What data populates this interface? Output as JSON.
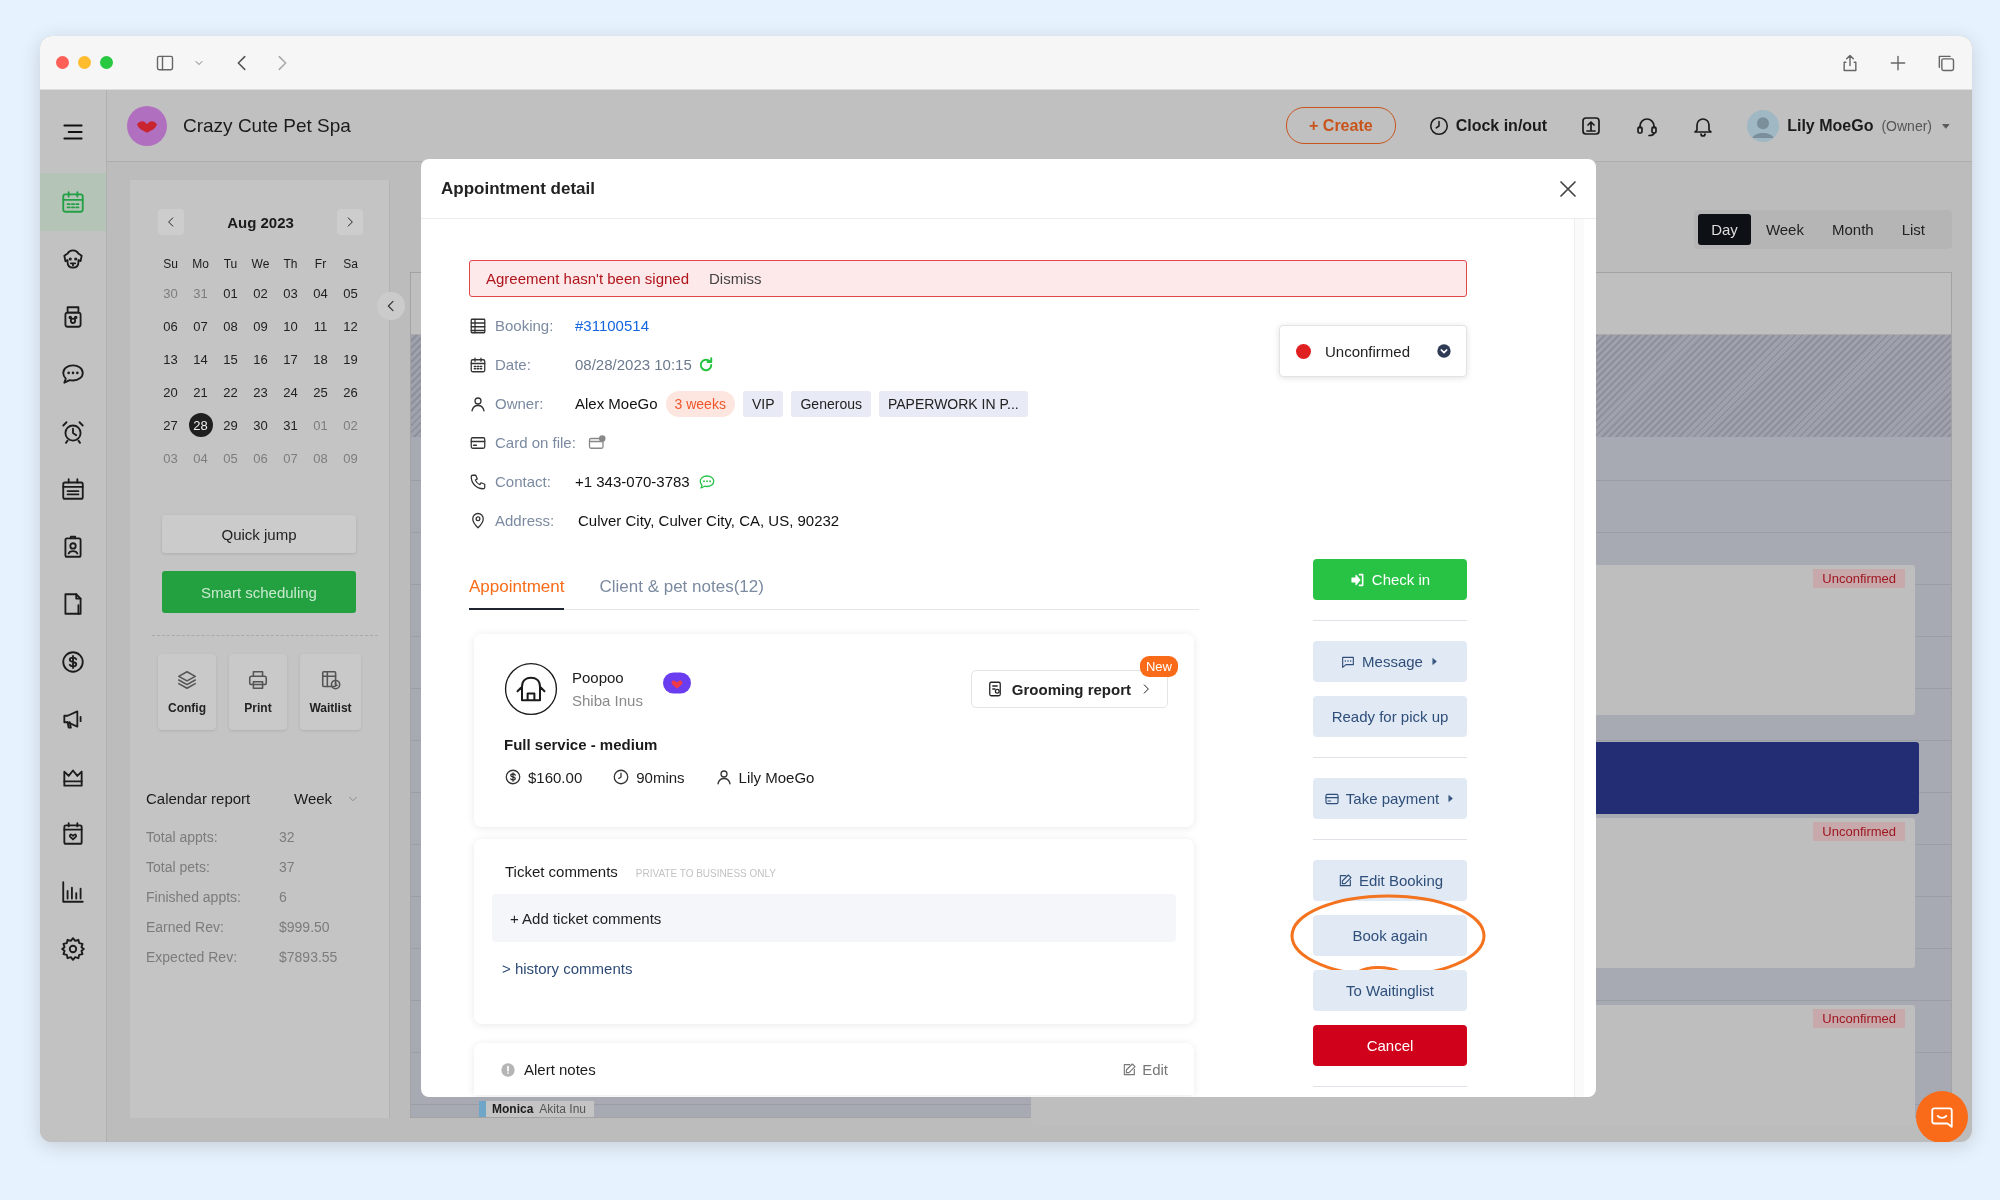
{
  "header": {
    "business_name": "Crazy Cute Pet Spa",
    "create": "+ Create",
    "clock": "Clock in/out",
    "user_name": "Lily MoeGo",
    "user_role": "(Owner)"
  },
  "nav": [
    {
      "selected": true
    },
    {
      "selected": false
    },
    {
      "selected": false
    },
    {
      "selected": false
    },
    {
      "selected": false
    },
    {
      "selected": false
    },
    {
      "selected": false
    },
    {
      "selected": false
    },
    {
      "selected": false
    },
    {
      "selected": false
    },
    {
      "selected": false
    },
    {
      "selected": false
    },
    {
      "selected": false
    },
    {
      "selected": false
    }
  ],
  "mini_calendar": {
    "title": "Aug 2023",
    "weekdays": [
      "Su",
      "Mo",
      "Tu",
      "We",
      "Th",
      "Fr",
      "Sa"
    ],
    "weeks": [
      [
        {
          "label": "30",
          "muted": true,
          "selected": false
        },
        {
          "label": "31",
          "muted": true,
          "selected": false
        },
        {
          "label": "01",
          "muted": false,
          "selected": false
        },
        {
          "label": "02",
          "muted": false,
          "selected": false
        },
        {
          "label": "03",
          "muted": false,
          "selected": false
        },
        {
          "label": "04",
          "muted": false,
          "selected": false
        },
        {
          "label": "05",
          "muted": false,
          "selected": false
        }
      ],
      [
        {
          "label": "06",
          "muted": false,
          "selected": false
        },
        {
          "label": "07",
          "muted": false,
          "selected": false
        },
        {
          "label": "08",
          "muted": false,
          "selected": false
        },
        {
          "label": "09",
          "muted": false,
          "selected": false
        },
        {
          "label": "10",
          "muted": false,
          "selected": false
        },
        {
          "label": "11",
          "muted": false,
          "selected": false
        },
        {
          "label": "12",
          "muted": false,
          "selected": false
        }
      ],
      [
        {
          "label": "13",
          "muted": false,
          "selected": false
        },
        {
          "label": "14",
          "muted": false,
          "selected": false
        },
        {
          "label": "15",
          "muted": false,
          "selected": false
        },
        {
          "label": "16",
          "muted": false,
          "selected": false
        },
        {
          "label": "17",
          "muted": false,
          "selected": false
        },
        {
          "label": "18",
          "muted": false,
          "selected": false
        },
        {
          "label": "19",
          "muted": false,
          "selected": false
        }
      ],
      [
        {
          "label": "20",
          "muted": false,
          "selected": false
        },
        {
          "label": "21",
          "muted": false,
          "selected": false
        },
        {
          "label": "22",
          "muted": false,
          "selected": false
        },
        {
          "label": "23",
          "muted": false,
          "selected": false
        },
        {
          "label": "24",
          "muted": false,
          "selected": false
        },
        {
          "label": "25",
          "muted": false,
          "selected": false
        },
        {
          "label": "26",
          "muted": false,
          "selected": false
        }
      ],
      [
        {
          "label": "27",
          "muted": false,
          "selected": false
        },
        {
          "label": "28",
          "muted": false,
          "selected": true
        },
        {
          "label": "29",
          "muted": false,
          "selected": false
        },
        {
          "label": "30",
          "muted": false,
          "selected": false
        },
        {
          "label": "31",
          "muted": false,
          "selected": false
        },
        {
          "label": "01",
          "muted": true,
          "selected": false
        },
        {
          "label": "02",
          "muted": true,
          "selected": false
        }
      ],
      [
        {
          "label": "03",
          "muted": true,
          "selected": false
        },
        {
          "label": "04",
          "muted": true,
          "selected": false
        },
        {
          "label": "05",
          "muted": true,
          "selected": false
        },
        {
          "label": "06",
          "muted": true,
          "selected": false
        },
        {
          "label": "07",
          "muted": true,
          "selected": false
        },
        {
          "label": "08",
          "muted": true,
          "selected": false
        },
        {
          "label": "09",
          "muted": true,
          "selected": false
        }
      ]
    ]
  },
  "quick_jump": "Quick jump",
  "smart_scheduling": "Smart scheduling",
  "tools": [
    {
      "kind": "layers",
      "label": "Config"
    },
    {
      "kind": "printer",
      "label": "Print"
    },
    {
      "kind": "waitlist",
      "label": "Waitlist"
    }
  ],
  "report": {
    "title": "Calendar report",
    "period": "Week",
    "stats": [
      {
        "label": "Total appts:",
        "value": "32"
      },
      {
        "label": "Total pets:",
        "value": "37"
      },
      {
        "label": "Finished appts:",
        "value": "6"
      },
      {
        "label": "Earned Rev:",
        "value": "$999.50"
      },
      {
        "label": "Expected Rev:",
        "value": "$7893.55"
      }
    ]
  },
  "views": [
    {
      "label": "Day",
      "selected": true
    },
    {
      "label": "Week",
      "selected": false
    },
    {
      "label": "Month",
      "selected": false
    },
    {
      "label": "List",
      "selected": false
    }
  ],
  "calendar_events": [
    {
      "kind": "appointment",
      "tag": "Unconfirmed"
    },
    {
      "kind": "blocked"
    },
    {
      "kind": "appointment",
      "tag": "Unconfirmed"
    },
    {
      "kind": "appointment",
      "tag": "Unconfirmed"
    },
    {
      "kind": "chip",
      "name": "Monica",
      "breed": "Akita Inu"
    }
  ],
  "modal": {
    "title": "Appointment detail",
    "alert": {
      "message": "Agreement hasn't been signed",
      "action": "Dismiss"
    },
    "details": [
      {
        "kind": "booking",
        "label": "Booking:",
        "value": "#31100514"
      },
      {
        "kind": "date",
        "label": "Date:",
        "value": "08/28/2023 10:15"
      },
      {
        "kind": "owner",
        "label": "Owner:",
        "value": "Alex MoeGo",
        "tags": [
          {
            "kind": "frequency",
            "text": "3 weeks"
          },
          {
            "kind": "tag",
            "text": "VIP"
          },
          {
            "kind": "tag",
            "text": "Generous"
          },
          {
            "kind": "tag",
            "text": "PAPERWORK IN P..."
          }
        ]
      },
      {
        "kind": "card",
        "label": "Card on file:"
      },
      {
        "kind": "contact",
        "label": "Contact:",
        "value": "+1 343-070-3783"
      },
      {
        "kind": "address",
        "label": "Address:",
        "value": "Culver City, Culver City, CA, US, 90232"
      }
    ],
    "status": {
      "label": "Unconfirmed",
      "color": "#e02020"
    },
    "tabs": [
      {
        "label": "Appointment",
        "selected": true
      },
      {
        "label": "Client & pet notes(12)",
        "selected": false
      }
    ],
    "pet": {
      "name": "Poopoo",
      "breed": "Shiba Inus",
      "report_button": "Grooming report",
      "badge": "New",
      "service": "Full service - medium",
      "price": "$160.00",
      "duration": "90mins",
      "staff": "Lily MoeGo"
    },
    "ticket_comments": {
      "title": "Ticket comments",
      "note": "PRIVATE TO BUSINESS ONLY",
      "add": "+ Add ticket comments",
      "history": "> history comments"
    },
    "alert_notes": {
      "title": "Alert notes",
      "edit": "Edit"
    },
    "action_groups": [
      [
        {
          "kind": "primary",
          "label": "Check in",
          "menu": false,
          "highlighted": false
        }
      ],
      [
        {
          "kind": "plain",
          "label": "Message",
          "menu": true,
          "highlighted": false
        },
        {
          "kind": "plain",
          "label": "Ready for pick up",
          "menu": false,
          "highlighted": false
        }
      ],
      [
        {
          "kind": "plain",
          "label": "Take payment",
          "menu": true,
          "highlighted": false
        }
      ],
      [
        {
          "kind": "plain",
          "label": "Edit Booking",
          "menu": false,
          "highlighted": false
        },
        {
          "kind": "plain",
          "label": "Book again",
          "menu": false,
          "highlighted": true
        },
        {
          "kind": "plain",
          "label": "To Waitinglist",
          "menu": false,
          "highlighted": false
        },
        {
          "kind": "danger",
          "label": "Cancel",
          "menu": false,
          "highlighted": false
        }
      ]
    ]
  }
}
